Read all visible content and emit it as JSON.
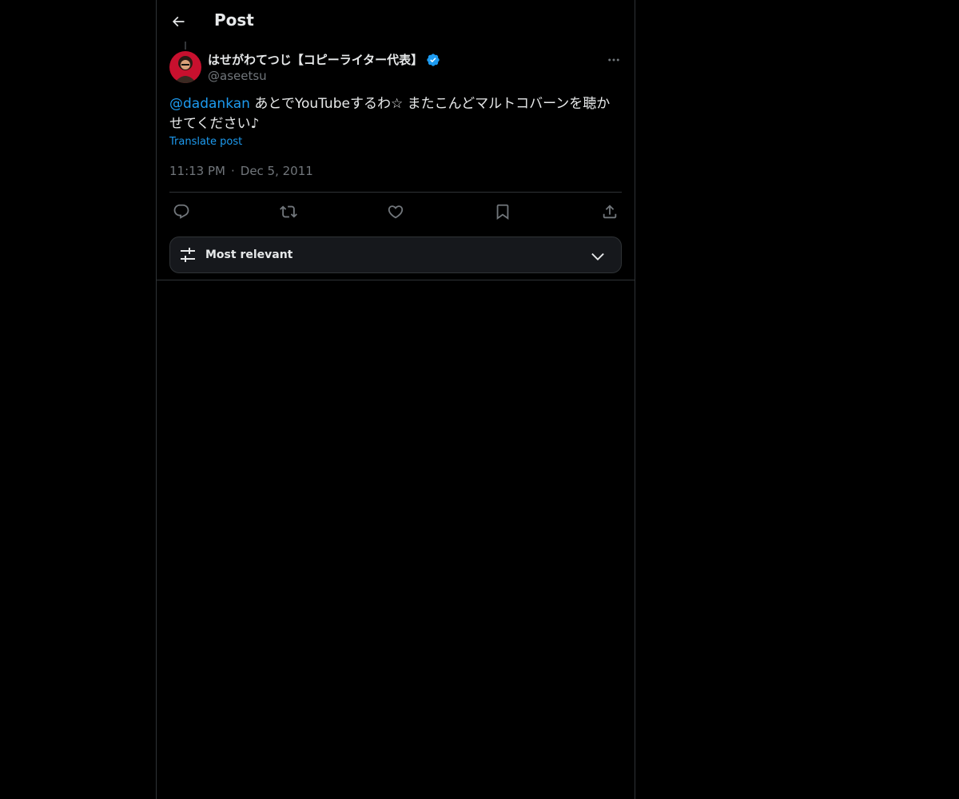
{
  "header": {
    "title": "Post",
    "back_icon": "arrow-left-icon"
  },
  "post": {
    "author": {
      "name": "はせがわてつじ【コピーライター代表】",
      "handle": "@aseetsu",
      "verified": true,
      "verified_color": "#1d9bf0"
    },
    "mention": "@dadankan",
    "text": " あとでYouTubeするわ☆ またこんどマルトコバーンを聴かせてください♪",
    "translate_label": "Translate post",
    "time": "11:13 PM",
    "separator": "·",
    "date": "Dec 5, 2011"
  },
  "actions": [
    {
      "name": "reply",
      "icon": "reply-icon"
    },
    {
      "name": "repost",
      "icon": "repost-icon"
    },
    {
      "name": "like",
      "icon": "heart-icon"
    },
    {
      "name": "bookmark",
      "icon": "bookmark-icon"
    },
    {
      "name": "share",
      "icon": "share-icon"
    }
  ],
  "replies_sort": {
    "label": "Most relevant",
    "icon": "sliders-icon",
    "chevron": "chevron-down-icon"
  },
  "colors": {
    "background": "#000000",
    "text": "#e7e9ea",
    "muted": "#71767b",
    "accent": "#1d9bf0",
    "border": "#2f3336"
  }
}
